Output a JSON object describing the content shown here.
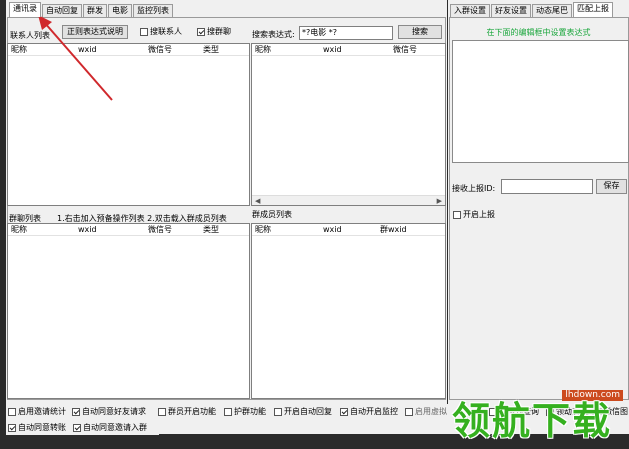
{
  "main_tabs": [
    "通讯录",
    "自动回复",
    "群发",
    "电影",
    "监控列表"
  ],
  "contacts": {
    "label": "联系人列表",
    "regex_help_button": "正则表达式说明",
    "search_contacts_checkbox": "搜联系人",
    "search_groups_checkbox": "搜群聊",
    "columns": [
      "昵称",
      "wxid",
      "微信号",
      "类型"
    ]
  },
  "search": {
    "label": "搜索表达式:",
    "value": "*?电影 *?",
    "button": "搜索",
    "columns": [
      "昵称",
      "wxid",
      "微信号"
    ]
  },
  "group_list": {
    "label": "群聊列表",
    "hint": "1.右击加入预备操作列表  2.双击载入群成员列表",
    "columns": [
      "昵称",
      "wxid",
      "微信号",
      "类型"
    ]
  },
  "members": {
    "label": "群成员列表",
    "columns": [
      "昵称",
      "wxid",
      "群wxid"
    ]
  },
  "right_tabs": [
    "入群设置",
    "好友设置",
    "动态尾巴",
    "匹配上报"
  ],
  "report": {
    "instruction": "在下面的编辑框中设置表达式",
    "receiver_label": "接收上报ID:",
    "save_button": "保存",
    "enable_checkbox": "开启上报"
  },
  "bottom_row1": [
    {
      "label": "启用邀请统计",
      "checked": false
    },
    {
      "label": "自动同意好友请求",
      "checked": true
    },
    {
      "label": "群员开启功能",
      "checked": false
    },
    {
      "label": "护群功能",
      "checked": false
    },
    {
      "label": "开启自动回复",
      "checked": false
    },
    {
      "label": "自动开启监控",
      "checked": true
    },
    {
      "label": "启用虚拟",
      "checked": false
    },
    {
      "label": "启用到查询",
      "checked": false
    },
    {
      "label": "领劫友发送过微信图",
      "checked": false
    }
  ],
  "bottom_row2": [
    {
      "label": "自动同意转账",
      "checked": true
    },
    {
      "label": "自动同意邀请入群",
      "checked": true
    }
  ],
  "colors": {
    "accent_green": "#1aa63c",
    "arrow_red": "#d0282c",
    "watermark_green": "#35b01f"
  },
  "watermark": {
    "site": "lhdown.com",
    "brand": "领航下载"
  }
}
